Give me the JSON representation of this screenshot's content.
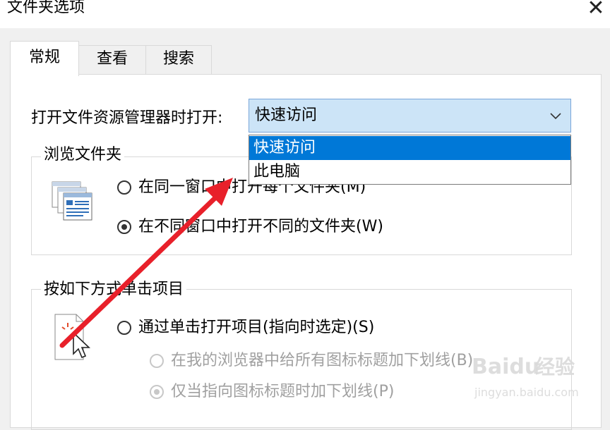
{
  "window": {
    "title": "文件夹选项"
  },
  "tabs": [
    {
      "label": "常规",
      "active": true
    },
    {
      "label": "查看",
      "active": false
    },
    {
      "label": "搜索",
      "active": false
    }
  ],
  "open_explorer": {
    "label": "打开文件资源管理器时打开:",
    "selected": "快速访问",
    "options": [
      "快速访问",
      "此电脑"
    ]
  },
  "browse_folders": {
    "legend": "浏览文件夹",
    "options": [
      {
        "label": "在同一窗口中打开每个文件夹(M)",
        "checked": false
      },
      {
        "label": "在不同窗口中打开不同的文件夹(W)",
        "checked": true
      }
    ]
  },
  "click_items": {
    "legend": "按如下方式单击项目",
    "options": [
      {
        "label": "通过单击打开项目(指向时选定)(S)",
        "checked": false,
        "disabled": false
      },
      {
        "label": "在我的浏览器中给所有图标标题加下划线(B)",
        "checked": false,
        "disabled": true
      },
      {
        "label": "仅当指向图标标题时加下划线(P)",
        "checked": true,
        "disabled": true
      }
    ]
  },
  "watermark": {
    "brand": "Baidu",
    "brand_cn": "经验",
    "url": "jingyan.baidu.com"
  },
  "colors": {
    "accent": "#0078d7",
    "combo_bg": "#cce4f7",
    "arrow": "#e8202a"
  }
}
